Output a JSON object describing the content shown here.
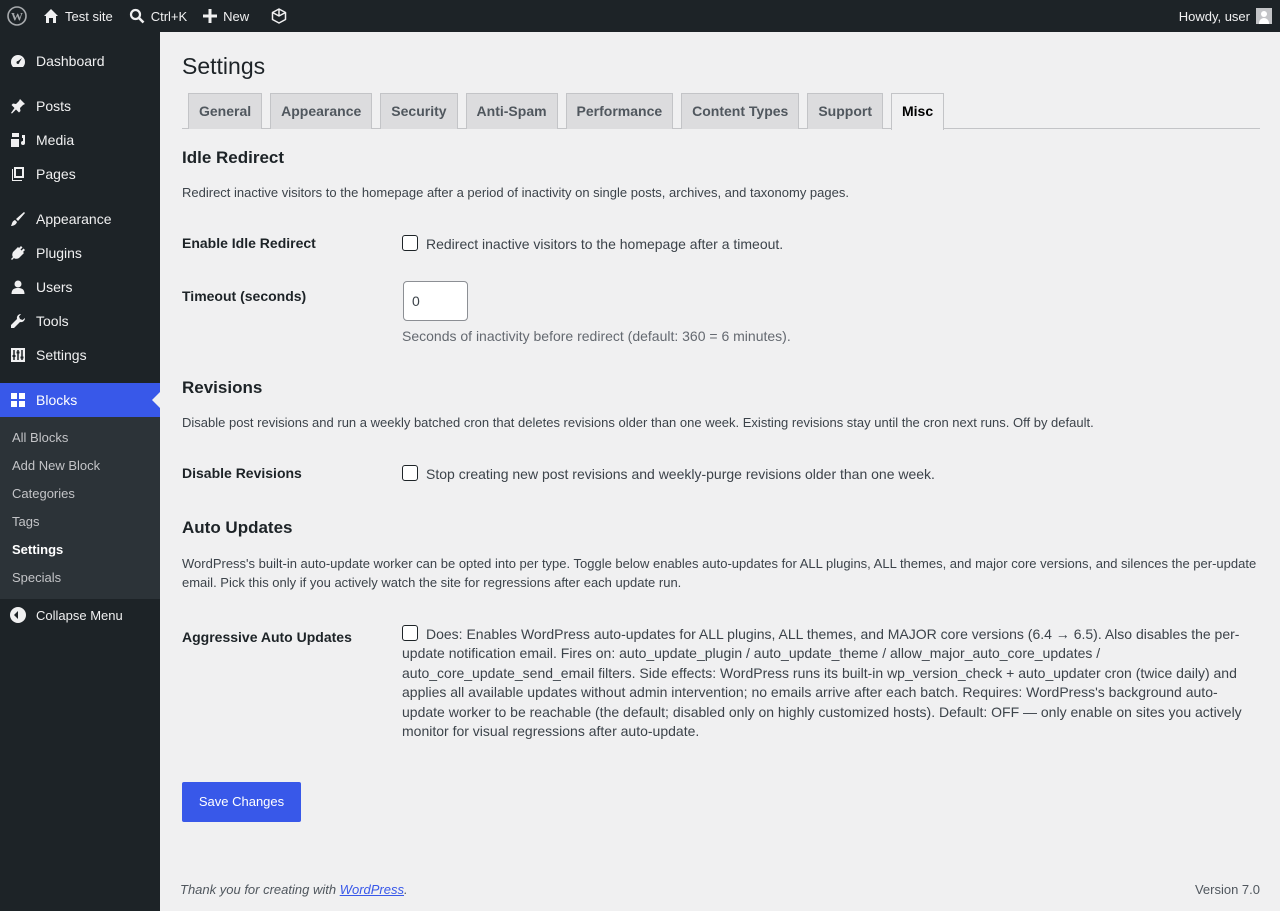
{
  "adminbar": {
    "site_name": "Test site",
    "search_shortcut": "Ctrl+K",
    "new_label": "New",
    "greeting": "Howdy, user"
  },
  "sidebar": {
    "items": [
      {
        "label": "Dashboard",
        "icon": "dashboard-icon"
      },
      {
        "label": "Posts",
        "icon": "pin-icon"
      },
      {
        "label": "Media",
        "icon": "media-icon"
      },
      {
        "label": "Pages",
        "icon": "pages-icon"
      },
      {
        "label": "Appearance",
        "icon": "brush-icon"
      },
      {
        "label": "Plugins",
        "icon": "plug-icon"
      },
      {
        "label": "Users",
        "icon": "user-icon"
      },
      {
        "label": "Tools",
        "icon": "wrench-icon"
      },
      {
        "label": "Settings",
        "icon": "sliders-icon"
      },
      {
        "label": "Blocks",
        "icon": "grid-icon"
      }
    ],
    "submenu": [
      "All Blocks",
      "Add New Block",
      "Categories",
      "Tags",
      "Settings",
      "Specials"
    ],
    "collapse_label": "Collapse Menu"
  },
  "page": {
    "title": "Settings",
    "tabs": [
      "General",
      "Appearance",
      "Security",
      "Anti-Spam",
      "Performance",
      "Content Types",
      "Support",
      "Misc"
    ],
    "active_tab": "Misc"
  },
  "idle": {
    "heading": "Idle Redirect",
    "description": "Redirect inactive visitors to the homepage after a period of inactivity on single posts, archives, and taxonomy pages.",
    "enable_label": "Enable Idle Redirect",
    "enable_text": "Redirect inactive visitors to the homepage after a timeout.",
    "timeout_label": "Timeout (seconds)",
    "timeout_value": "0",
    "timeout_hint": "Seconds of inactivity before redirect (default: 360 = 6 minutes)."
  },
  "revisions": {
    "heading": "Revisions",
    "description": "Disable post revisions and run a weekly batched cron that deletes revisions older than one week. Existing revisions stay until the cron next runs. Off by default.",
    "label": "Disable Revisions",
    "text": "Stop creating new post revisions and weekly-purge revisions older than one week."
  },
  "autoupdates": {
    "heading": "Auto Updates",
    "description": "WordPress's built-in auto-update worker can be opted into per type. Toggle below enables auto-updates for ALL plugins, ALL themes, and major core versions, and silences the per-update email. Pick this only if you actively watch the site for regressions after each update run.",
    "label": "Aggressive Auto Updates",
    "text": "Does: Enables WordPress auto-updates for ALL plugins, ALL themes, and MAJOR core versions (6.4 → 6.5). Also disables the per-update notification email. Fires on: auto_update_plugin / auto_update_theme / allow_major_auto_core_updates / auto_core_update_send_email filters. Side effects: WordPress runs its built-in wp_version_check + auto_updater cron (twice daily) and applies all available updates without admin intervention; no emails arrive after each batch. Requires: WordPress's background auto-update worker to be reachable (the default; disabled only on highly customized hosts). Default: OFF — only enable on sites you actively monitor for visual regressions after auto-update."
  },
  "save_label": "Save Changes",
  "footer": {
    "thanks_prefix": "Thank you for creating with ",
    "thanks_link": "WordPress",
    "thanks_suffix": ".",
    "version": "Version 7.0"
  }
}
